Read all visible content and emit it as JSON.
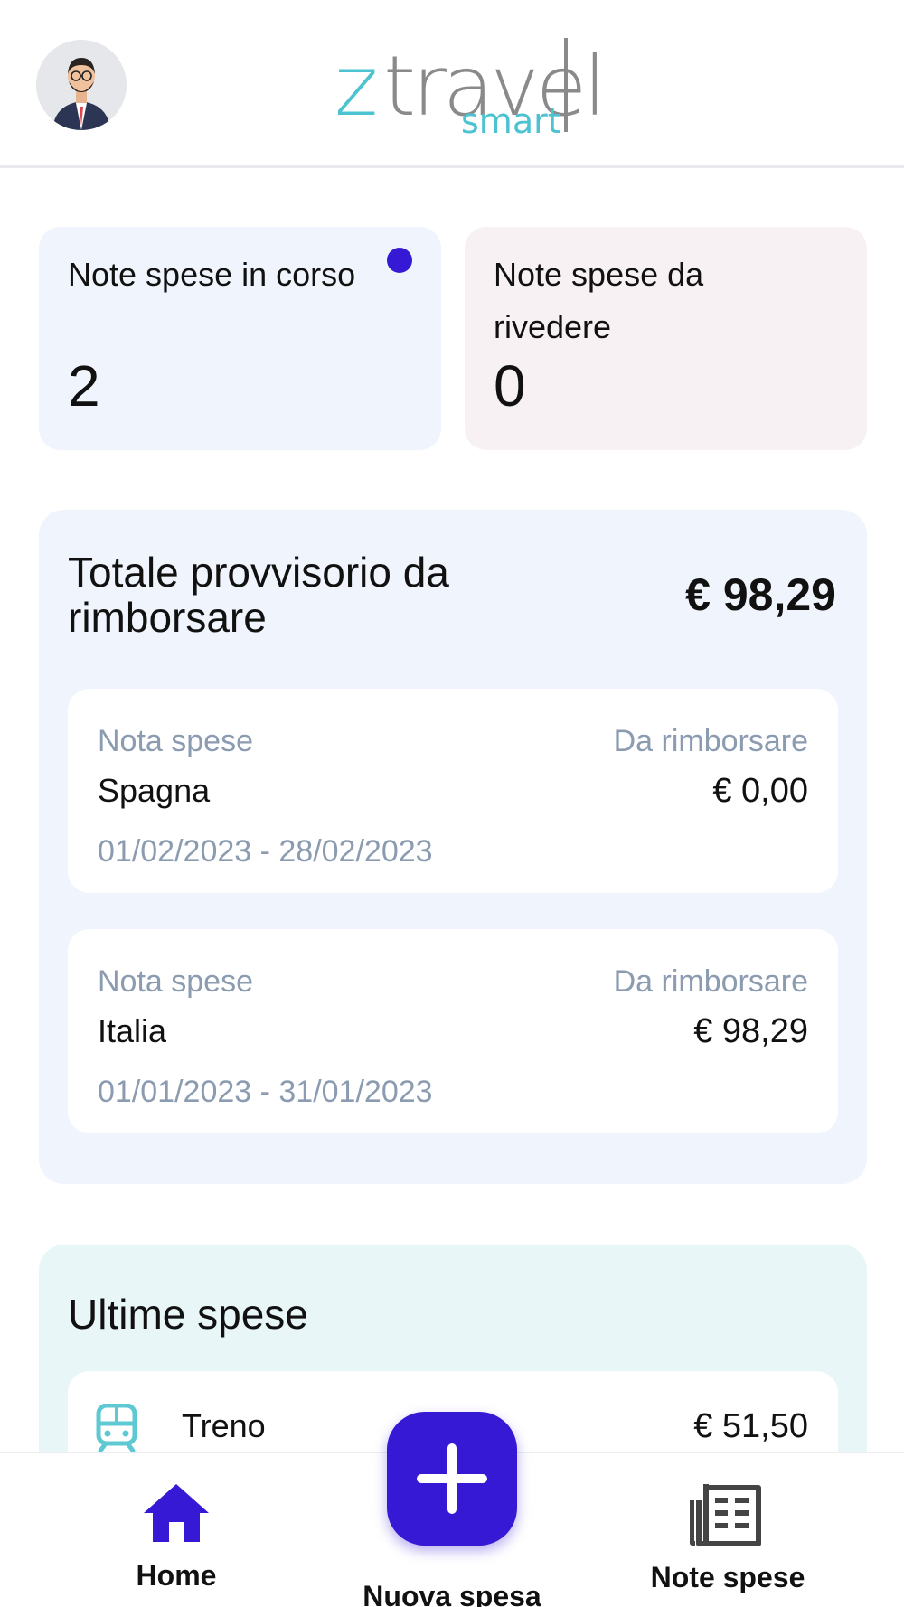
{
  "header": {
    "logo_z": "z",
    "logo_travel": "travel",
    "logo_smart": "smart",
    "avatar_icon": "user-avatar-icon"
  },
  "stats": [
    {
      "label": "Note spese in corso",
      "value": "2",
      "indicator_color": "#3519d4"
    },
    {
      "label": "Note spese da rivedere",
      "value": "0"
    }
  ],
  "totale": {
    "title": "Totale provvisorio da rimborsare",
    "amount": "€ 98,29",
    "notes": [
      {
        "key_left": "Nota spese",
        "key_right": "Da rimborsare",
        "name": "Spagna",
        "amount": "€ 0,00",
        "dates": "01/02/2023 - 28/02/2023"
      },
      {
        "key_left": "Nota spese",
        "key_right": "Da rimborsare",
        "name": "Italia",
        "amount": "€ 98,29",
        "dates": "01/01/2023 - 31/01/2023"
      }
    ]
  },
  "ultime": {
    "title": "Ultime spese",
    "items": [
      {
        "icon": "train-icon",
        "label": "Treno",
        "amount": "€ 51,50"
      }
    ]
  },
  "nav": {
    "home": "Home",
    "nuova": "Nuova spesa",
    "note": "Note spese"
  },
  "colors": {
    "accent": "#3519d4",
    "teal": "#4cc3d1",
    "muted": "#8b9bb0"
  }
}
